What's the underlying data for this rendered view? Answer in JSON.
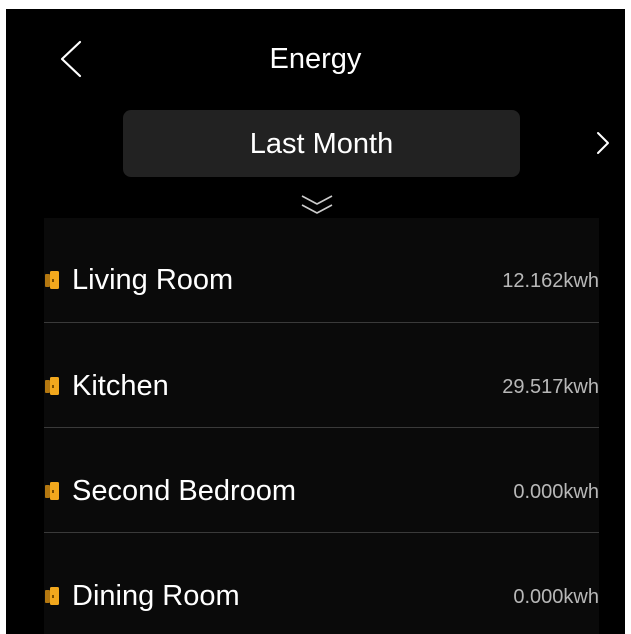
{
  "header": {
    "title": "Energy",
    "back_icon": "chevron-left-icon"
  },
  "period": {
    "label": "Last Month",
    "arrow_icon": "chevron-right-icon"
  },
  "expand_icon": "double-chevron-down-icon",
  "colors": {
    "background": "#000000",
    "panel": "#222222",
    "list_background": "#0a0a0a",
    "text": "#ffffff",
    "value_text": "#b8b8b8",
    "divider": "#3a3a3a",
    "door_icon": "#f2a81d"
  },
  "rooms": [
    {
      "name": "Living Room",
      "value": "12.162kwh",
      "icon": "door-icon"
    },
    {
      "name": "Kitchen",
      "value": "29.517kwh",
      "icon": "door-icon"
    },
    {
      "name": "Second Bedroom",
      "value": "0.000kwh",
      "icon": "door-icon"
    },
    {
      "name": "Dining Room",
      "value": "0.000kwh",
      "icon": "door-icon"
    }
  ]
}
